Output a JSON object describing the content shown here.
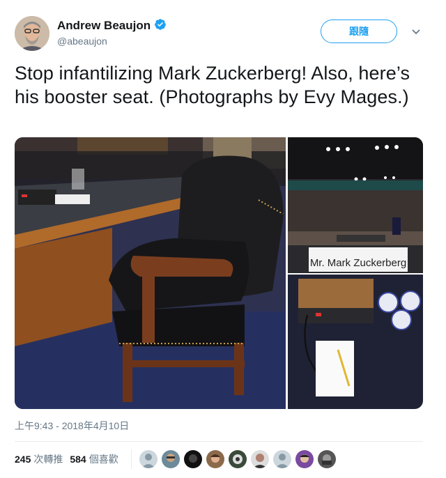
{
  "author": {
    "name": "Andrew Beaujon",
    "handle": "@abeaujon",
    "verified": true,
    "avatar_icon": "user-avatar-icon"
  },
  "follow_button": {
    "label": "跟隨"
  },
  "tweet": {
    "text": "Stop infantilizing Mark Zuckerberg! Also, here’s his booster seat. (Photographs by Evy Mages.)"
  },
  "media": {
    "nameplate_text": "Mr. Mark Zuckerberg",
    "photos": [
      "chair-photo",
      "hearing-room-photo",
      "desk-items-photo"
    ]
  },
  "timestamp": "上午9:43 - 2018年4月10日",
  "stats": {
    "retweets_count": "245",
    "retweets_label": "次轉推",
    "likes_count": "584",
    "likes_label": "個喜歡"
  },
  "colors": {
    "accent": "#1da1f2",
    "secondary_text": "#657786",
    "primary_text": "#14171a"
  }
}
